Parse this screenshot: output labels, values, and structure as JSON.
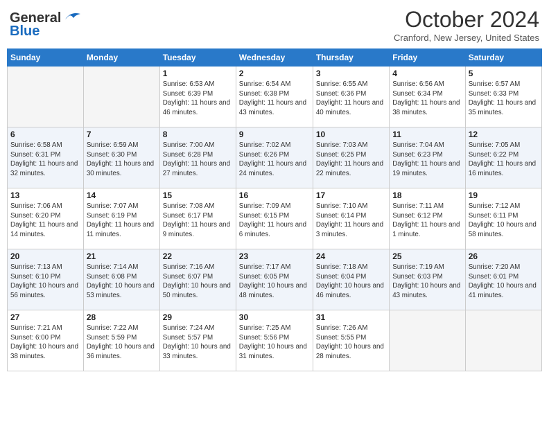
{
  "header": {
    "logo_line1": "General",
    "logo_line2": "Blue",
    "month": "October 2024",
    "location": "Cranford, New Jersey, United States"
  },
  "days_of_week": [
    "Sunday",
    "Monday",
    "Tuesday",
    "Wednesday",
    "Thursday",
    "Friday",
    "Saturday"
  ],
  "weeks": [
    [
      {
        "day": "",
        "info": ""
      },
      {
        "day": "",
        "info": ""
      },
      {
        "day": "1",
        "info": "Sunrise: 6:53 AM\nSunset: 6:39 PM\nDaylight: 11 hours and 46 minutes."
      },
      {
        "day": "2",
        "info": "Sunrise: 6:54 AM\nSunset: 6:38 PM\nDaylight: 11 hours and 43 minutes."
      },
      {
        "day": "3",
        "info": "Sunrise: 6:55 AM\nSunset: 6:36 PM\nDaylight: 11 hours and 40 minutes."
      },
      {
        "day": "4",
        "info": "Sunrise: 6:56 AM\nSunset: 6:34 PM\nDaylight: 11 hours and 38 minutes."
      },
      {
        "day": "5",
        "info": "Sunrise: 6:57 AM\nSunset: 6:33 PM\nDaylight: 11 hours and 35 minutes."
      }
    ],
    [
      {
        "day": "6",
        "info": "Sunrise: 6:58 AM\nSunset: 6:31 PM\nDaylight: 11 hours and 32 minutes."
      },
      {
        "day": "7",
        "info": "Sunrise: 6:59 AM\nSunset: 6:30 PM\nDaylight: 11 hours and 30 minutes."
      },
      {
        "day": "8",
        "info": "Sunrise: 7:00 AM\nSunset: 6:28 PM\nDaylight: 11 hours and 27 minutes."
      },
      {
        "day": "9",
        "info": "Sunrise: 7:02 AM\nSunset: 6:26 PM\nDaylight: 11 hours and 24 minutes."
      },
      {
        "day": "10",
        "info": "Sunrise: 7:03 AM\nSunset: 6:25 PM\nDaylight: 11 hours and 22 minutes."
      },
      {
        "day": "11",
        "info": "Sunrise: 7:04 AM\nSunset: 6:23 PM\nDaylight: 11 hours and 19 minutes."
      },
      {
        "day": "12",
        "info": "Sunrise: 7:05 AM\nSunset: 6:22 PM\nDaylight: 11 hours and 16 minutes."
      }
    ],
    [
      {
        "day": "13",
        "info": "Sunrise: 7:06 AM\nSunset: 6:20 PM\nDaylight: 11 hours and 14 minutes."
      },
      {
        "day": "14",
        "info": "Sunrise: 7:07 AM\nSunset: 6:19 PM\nDaylight: 11 hours and 11 minutes."
      },
      {
        "day": "15",
        "info": "Sunrise: 7:08 AM\nSunset: 6:17 PM\nDaylight: 11 hours and 9 minutes."
      },
      {
        "day": "16",
        "info": "Sunrise: 7:09 AM\nSunset: 6:15 PM\nDaylight: 11 hours and 6 minutes."
      },
      {
        "day": "17",
        "info": "Sunrise: 7:10 AM\nSunset: 6:14 PM\nDaylight: 11 hours and 3 minutes."
      },
      {
        "day": "18",
        "info": "Sunrise: 7:11 AM\nSunset: 6:12 PM\nDaylight: 11 hours and 1 minute."
      },
      {
        "day": "19",
        "info": "Sunrise: 7:12 AM\nSunset: 6:11 PM\nDaylight: 10 hours and 58 minutes."
      }
    ],
    [
      {
        "day": "20",
        "info": "Sunrise: 7:13 AM\nSunset: 6:10 PM\nDaylight: 10 hours and 56 minutes."
      },
      {
        "day": "21",
        "info": "Sunrise: 7:14 AM\nSunset: 6:08 PM\nDaylight: 10 hours and 53 minutes."
      },
      {
        "day": "22",
        "info": "Sunrise: 7:16 AM\nSunset: 6:07 PM\nDaylight: 10 hours and 50 minutes."
      },
      {
        "day": "23",
        "info": "Sunrise: 7:17 AM\nSunset: 6:05 PM\nDaylight: 10 hours and 48 minutes."
      },
      {
        "day": "24",
        "info": "Sunrise: 7:18 AM\nSunset: 6:04 PM\nDaylight: 10 hours and 46 minutes."
      },
      {
        "day": "25",
        "info": "Sunrise: 7:19 AM\nSunset: 6:03 PM\nDaylight: 10 hours and 43 minutes."
      },
      {
        "day": "26",
        "info": "Sunrise: 7:20 AM\nSunset: 6:01 PM\nDaylight: 10 hours and 41 minutes."
      }
    ],
    [
      {
        "day": "27",
        "info": "Sunrise: 7:21 AM\nSunset: 6:00 PM\nDaylight: 10 hours and 38 minutes."
      },
      {
        "day": "28",
        "info": "Sunrise: 7:22 AM\nSunset: 5:59 PM\nDaylight: 10 hours and 36 minutes."
      },
      {
        "day": "29",
        "info": "Sunrise: 7:24 AM\nSunset: 5:57 PM\nDaylight: 10 hours and 33 minutes."
      },
      {
        "day": "30",
        "info": "Sunrise: 7:25 AM\nSunset: 5:56 PM\nDaylight: 10 hours and 31 minutes."
      },
      {
        "day": "31",
        "info": "Sunrise: 7:26 AM\nSunset: 5:55 PM\nDaylight: 10 hours and 28 minutes."
      },
      {
        "day": "",
        "info": ""
      },
      {
        "day": "",
        "info": ""
      }
    ]
  ]
}
